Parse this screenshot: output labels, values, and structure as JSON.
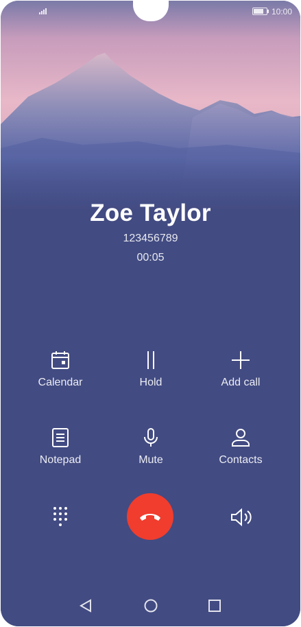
{
  "status_bar": {
    "time": "10:00",
    "battery_level": 0.8
  },
  "call": {
    "name": "Zoe Taylor",
    "number": "123456789",
    "duration": "00:05"
  },
  "actions": [
    {
      "label": "Calendar",
      "icon": "calendar-icon"
    },
    {
      "label": "Hold",
      "icon": "pause-icon"
    },
    {
      "label": "Add call",
      "icon": "plus-icon"
    },
    {
      "label": "Notepad",
      "icon": "notepad-icon"
    },
    {
      "label": "Mute",
      "icon": "microphone-icon"
    },
    {
      "label": "Contacts",
      "icon": "person-icon"
    }
  ],
  "bottom_controls": {
    "keypad_icon": "keypad-icon",
    "end_call_icon": "end-call-icon",
    "speaker_icon": "speaker-icon"
  },
  "navigation": {
    "back": "back-triangle-icon",
    "home": "home-circle-icon",
    "recents": "recents-square-icon"
  },
  "colors": {
    "background": "#424b82",
    "end_call": "#f03d2e",
    "sky_top": "#c8a0b8"
  }
}
